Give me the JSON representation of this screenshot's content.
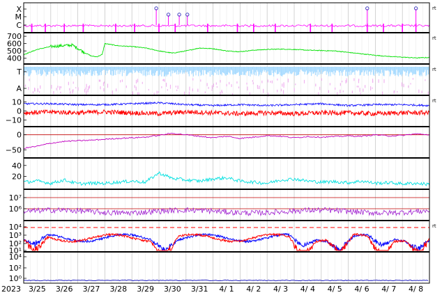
{
  "chart_data": {
    "type": "line",
    "start_year_label": "2023",
    "dates": [
      "3/25",
      "3/26",
      "3/27",
      "3/28",
      "3/29",
      "3/30",
      "3/31",
      "4/ 1",
      "4/ 2",
      "4/ 3",
      "4/ 4",
      "4/ 5",
      "4/ 6",
      "4/ 7",
      "4/ 8"
    ],
    "colors": {
      "magenta": "#ff00ff",
      "green": "#00e000",
      "lightblue": "#aadcff",
      "pink": "#f0b4f0",
      "blue": "#0000ff",
      "red": "#ff0000",
      "purple": "#c000c0",
      "cyan": "#00e0e0",
      "violet": "#a020d0",
      "navy": "#2020c0"
    },
    "panels": [
      {
        "id": "flare",
        "tick_labels": [
          "X",
          "M",
          "C"
        ],
        "right_mark": "rt",
        "series": [
          {
            "color": "magenta",
            "kind": "flare"
          }
        ],
        "markers_day": [
          4.9,
          5.35,
          5.75,
          6.05,
          12.7,
          14.5
        ]
      },
      {
        "id": "wind-speed",
        "tick_labels": [
          "700",
          "600",
          "500",
          "400"
        ],
        "ylim": [
          350,
          720
        ],
        "right_mark": "rt",
        "series": [
          {
            "color": "green",
            "day": [
              0,
              0.5,
              1,
              1.4,
              1.8,
              2.2,
              2.5,
              2.7,
              2.9,
              3.0,
              3.5,
              4,
              4.5,
              5,
              5.5,
              6,
              6.5,
              7,
              7.5,
              8,
              8.5,
              9,
              9.5,
              10,
              10.5,
              11,
              11.5,
              12,
              12.5,
              13,
              13.5,
              14,
              14.5,
              15
            ],
            "value": [
              450,
              520,
              560,
              570,
              580,
              490,
              430,
              420,
              450,
              600,
              570,
              560,
              540,
              500,
              470,
              500,
              540,
              530,
              500,
              490,
              510,
              520,
              525,
              520,
              510,
              505,
              500,
              480,
              460,
              440,
              425,
              415,
              405,
              410
            ]
          }
        ]
      },
      {
        "id": "bz-flags",
        "tick_labels": [
          "T",
          "A"
        ],
        "right_mark": "rt",
        "series": [
          {
            "color": "lightblue",
            "kind": "band"
          },
          {
            "color": "pink",
            "kind": "sparse"
          }
        ]
      },
      {
        "id": "imf",
        "tick_labels": [
          "10",
          "0",
          "−10"
        ],
        "ylim": [
          -15,
          15
        ],
        "right_mark": "rt",
        "series": [
          {
            "color": "blue",
            "day": [
              0,
              1,
              2,
              3,
              4,
              5,
              6,
              7,
              8,
              9,
              10,
              11,
              12,
              13,
              14,
              15
            ],
            "value": [
              8,
              8,
              7,
              7,
              8,
              9,
              7,
              6,
              7,
              6,
              7,
              8,
              6,
              7,
              7,
              6
            ]
          },
          {
            "color": "red",
            "day": [
              0,
              1,
              2,
              3,
              4,
              5,
              6,
              7,
              8,
              9,
              10,
              11,
              12,
              13,
              14,
              15
            ],
            "value": [
              -2,
              -1,
              -2,
              -1,
              -2,
              -3,
              -1,
              -2,
              -3,
              -2,
              -3,
              -2,
              -2,
              -3,
              -2,
              -2
            ]
          }
        ]
      },
      {
        "id": "dst",
        "tick_labels": [
          "0",
          "−50"
        ],
        "ylim": [
          -70,
          20
        ],
        "series": [
          {
            "color": "purple",
            "day": [
              0,
              0.5,
              1,
              1.5,
              2,
              2.5,
              3,
              3.5,
              4,
              4.5,
              5,
              5.5,
              6,
              6.5,
              7,
              7.5,
              8,
              8.5,
              9,
              9.5,
              10,
              10.5,
              11,
              11.5,
              12,
              12.5,
              13,
              13.5,
              14,
              14.5,
              15
            ],
            "value": [
              -45,
              -38,
              -28,
              -22,
              -20,
              -18,
              -15,
              -12,
              -10,
              -8,
              -2,
              5,
              0,
              -5,
              -10,
              -5,
              -12,
              -8,
              -3,
              -5,
              -10,
              -6,
              -8,
              -6,
              -4,
              -5,
              0,
              -4,
              -2,
              3,
              0
            ]
          }
        ]
      },
      {
        "id": "kp",
        "tick_labels": [
          "40",
          "20"
        ],
        "ylim": [
          0,
          50
        ],
        "series": [
          {
            "color": "cyan",
            "day": [
              0,
              0.5,
              1,
              1.5,
              2,
              2.5,
              3,
              3.5,
              4,
              4.5,
              5,
              5.5,
              6,
              6.5,
              7,
              7.5,
              8,
              8.5,
              9,
              9.5,
              10,
              10.5,
              11,
              11.5,
              12,
              12.5,
              13,
              13.5,
              14,
              14.5,
              15
            ],
            "value": [
              8,
              10,
              6,
              12,
              5,
              6,
              6,
              8,
              10,
              8,
              25,
              15,
              12,
              10,
              14,
              16,
              10,
              8,
              6,
              12,
              14,
              10,
              8,
              9,
              7,
              10,
              6,
              7,
              5,
              6,
              4
            ]
          }
        ]
      },
      {
        "id": "electron",
        "tick_labels": [
          "10⁷",
          "10⁶"
        ],
        "log_lines": [
          7,
          6
        ],
        "series": [
          {
            "color": "violet",
            "kind": "noise"
          }
        ]
      },
      {
        "id": "proton",
        "tick_labels": [
          "10⁴",
          "10³",
          "10²",
          "10¹"
        ],
        "right_mark": "rt",
        "series": [
          {
            "color": "blue",
            "kind": "proton"
          },
          {
            "color": "red",
            "kind": "proton"
          }
        ]
      },
      {
        "id": "xray",
        "tick_labels": [
          "10⁴",
          "10²",
          "10⁰"
        ],
        "series": [
          {
            "color": "navy",
            "kind": "flat"
          }
        ]
      }
    ]
  }
}
